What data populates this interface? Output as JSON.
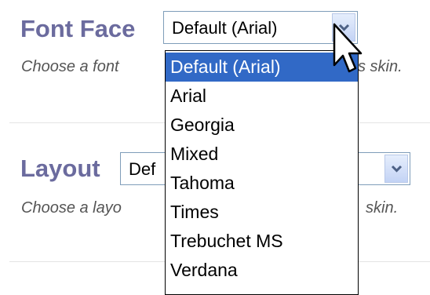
{
  "font_face": {
    "label": "Font Face",
    "value": "Default (Arial)",
    "help_visible_left": "Choose a font",
    "help_visible_right": "s skin."
  },
  "layout": {
    "label": "Layout",
    "value_visible": "Def",
    "help_visible_left": "Choose a layo",
    "help_visible_right": "skin."
  },
  "font_options": [
    "Default (Arial)",
    "Arial",
    "Georgia",
    "Mixed",
    "Tahoma",
    "Times",
    "Trebuchet MS",
    "Verdana"
  ],
  "selected_option_index": 0,
  "colors": {
    "label": "#6b6b9e",
    "selection": "#3169c6",
    "select_border": "#7f9db9"
  },
  "icons": {
    "dropdown_arrow": "chevron-down-icon",
    "cursor": "mouse-pointer-icon"
  }
}
